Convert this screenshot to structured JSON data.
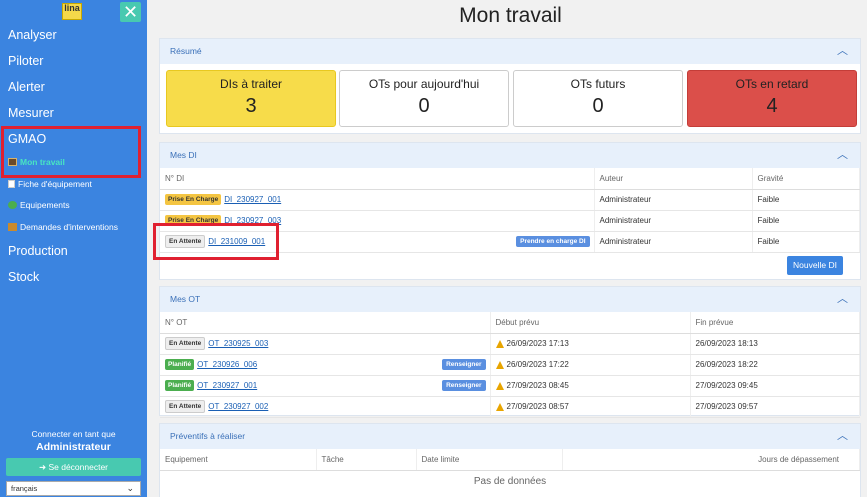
{
  "sidebar": {
    "logo_text": "lina",
    "close_glyph": "✕",
    "nav": {
      "analyser": "Analyser",
      "piloter": "Piloter",
      "alerter": "Alerter",
      "mesurer": "Mesurer",
      "gmao": "GMAO",
      "production": "Production",
      "stock": "Stock"
    },
    "sub": {
      "mon_travail": "Mon travail",
      "fiche": "Fiche d'équipement",
      "equipements": "Equipements",
      "demandes": "Demandes d'interventions"
    },
    "connect_label": "Connecter en tant que",
    "user": "Administrateur",
    "logout": "Se déconnecter",
    "language": "français"
  },
  "main": {
    "title": "Mon travail",
    "resume": {
      "header": "Résumé",
      "cards": [
        {
          "label": "DIs à traiter",
          "value": "3"
        },
        {
          "label": "OTs pour aujourd'hui",
          "value": "0"
        },
        {
          "label": "OTs futurs",
          "value": "0"
        },
        {
          "label": "OTs en retard",
          "value": "4"
        }
      ]
    },
    "mes_di": {
      "header": "Mes DI",
      "columns": [
        "N° DI",
        "Auteur",
        "Gravité"
      ],
      "rows": [
        {
          "status": "Prise En Charge",
          "id": "DI_230927_001",
          "author": "Administrateur",
          "gravity": "Faible"
        },
        {
          "status": "Prise En Charge",
          "id": "DI_230927_003",
          "author": "Administrateur",
          "gravity": "Faible"
        },
        {
          "status": "En Attente",
          "id": "DI_231009_001",
          "action": "Prendre en charge DI",
          "author": "Administrateur",
          "gravity": "Faible"
        }
      ],
      "new_button": "Nouvelle DI"
    },
    "mes_ot": {
      "header": "Mes OT",
      "columns": [
        "N° OT",
        "Début prévu",
        "Fin prévue"
      ],
      "rows": [
        {
          "status": "En Attente",
          "id": "OT_230925_003",
          "start": "26/09/2023 17:13",
          "end": "26/09/2023 18:13"
        },
        {
          "status": "Planifié",
          "id": "OT_230926_006",
          "action": "Renseigner",
          "start": "26/09/2023 17:22",
          "end": "26/09/2023 18:22"
        },
        {
          "status": "Planifié",
          "id": "OT_230927_001",
          "action": "Renseigner",
          "start": "27/09/2023 08:45",
          "end": "27/09/2023 09:45"
        },
        {
          "status": "En Attente",
          "id": "OT_230927_002",
          "start": "27/09/2023 08:57",
          "end": "27/09/2023 09:57"
        }
      ]
    },
    "preventifs": {
      "header": "Préventifs à réaliser",
      "columns": [
        "Equipement",
        "Tâche",
        "Date limite",
        "Jours de dépassement"
      ],
      "empty": "Pas de données"
    }
  },
  "colors": {
    "sidebar": "#3b84e0",
    "accent": "#48c9b0",
    "highlight": "#e02030",
    "late": "#db4f4a",
    "todo": "#f7dc4a"
  }
}
